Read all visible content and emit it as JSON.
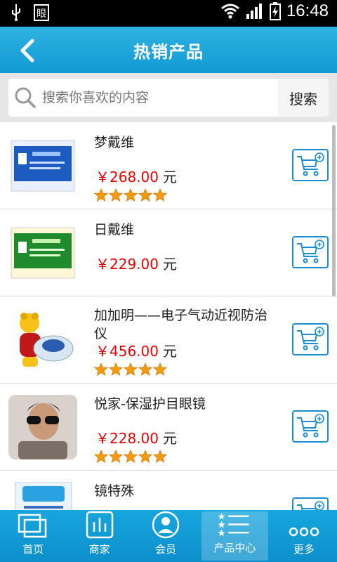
{
  "status_bar": {
    "time": "16:48"
  },
  "header": {
    "title": "热销产品"
  },
  "search": {
    "placeholder": "搜索你喜欢的内容",
    "button": "搜索"
  },
  "products": [
    {
      "name": "梦戴维",
      "price": "￥268.00",
      "unit": "元",
      "rating": 5
    },
    {
      "name": "日戴维",
      "price": "￥229.00",
      "unit": "元",
      "rating": 0
    },
    {
      "name": "加加明——电子气动近视防治仪",
      "price": "￥456.00",
      "unit": "元",
      "rating": 5
    },
    {
      "name": "悦家-保湿护目眼镜",
      "price": "￥228.00",
      "unit": "元",
      "rating": 5
    },
    {
      "name": "镜特殊",
      "price": "",
      "unit": "",
      "rating": 0
    }
  ],
  "tabs": [
    {
      "label": "首页"
    },
    {
      "label": "商家"
    },
    {
      "label": "会员"
    },
    {
      "label": "产品中心",
      "active": true
    },
    {
      "label": "更多"
    }
  ],
  "colors": {
    "accent": "#129ad3",
    "price": "#e00000",
    "star": "#f39c12"
  }
}
